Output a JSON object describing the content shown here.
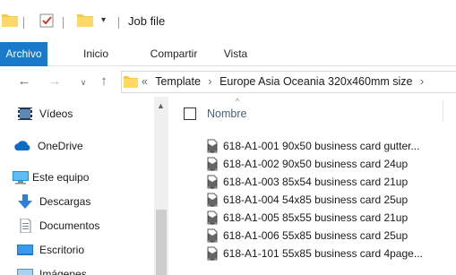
{
  "window": {
    "title": "Job file",
    "qat_dropdown_glyph": "▾"
  },
  "ribbon": {
    "tabs": [
      {
        "label": "Archivo",
        "active": true
      },
      {
        "label": "Inicio",
        "active": false
      },
      {
        "label": "Compartir",
        "active": false
      },
      {
        "label": "Vista",
        "active": false
      }
    ]
  },
  "nav_buttons": {
    "back": "←",
    "forward": "→",
    "recent": "∨",
    "up": "↑"
  },
  "address": {
    "overflow": "«",
    "segments": [
      "Template",
      "Europe Asia Oceania 320x460mm size"
    ],
    "separator": "›"
  },
  "sidebar": {
    "items": [
      {
        "label": "Vídeos",
        "icon": "video-folder-icon"
      },
      {
        "label": "OneDrive",
        "icon": "onedrive-cloud-icon"
      },
      {
        "label": "Este equipo",
        "icon": "computer-icon"
      },
      {
        "label": "Descargas",
        "icon": "download-arrow-icon"
      },
      {
        "label": "Documentos",
        "icon": "document-icon"
      },
      {
        "label": "Escritorio",
        "icon": "desktop-icon"
      },
      {
        "label": "Imágenes",
        "icon": "pictures-icon"
      }
    ]
  },
  "file_list": {
    "column_header": "Nombre",
    "sort_glyph": "^",
    "files": [
      "618-A1-001 90x50 business card gutter...",
      "618-A1-002 90x50 business card 24up",
      "618-A1-003 85x54 business card 21up",
      "618-A1-004 54x85 business card 25up",
      "618-A1-005 85x55 business card 21up",
      "618-A1-006 55x85 business card 25up",
      "618-A1-101 55x85 business card 4page..."
    ]
  },
  "colors": {
    "accent": "#1979ca",
    "folder_yellow": "#f7c948",
    "header_text": "#4c607a"
  }
}
